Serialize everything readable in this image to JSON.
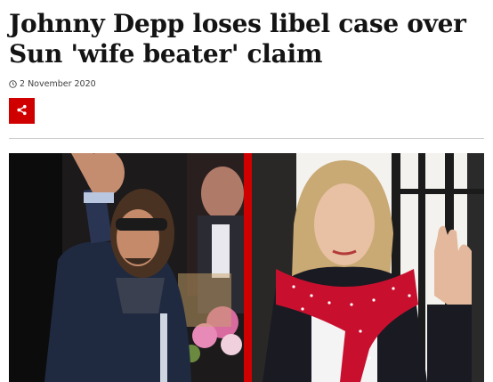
{
  "article": {
    "headline": "Johnny Depp loses libel case over Sun 'wife beater' claim",
    "date": "2 November 2020",
    "date_icon": "clock-icon",
    "share_icon": "share-icon",
    "accent_color": "#d10000"
  }
}
